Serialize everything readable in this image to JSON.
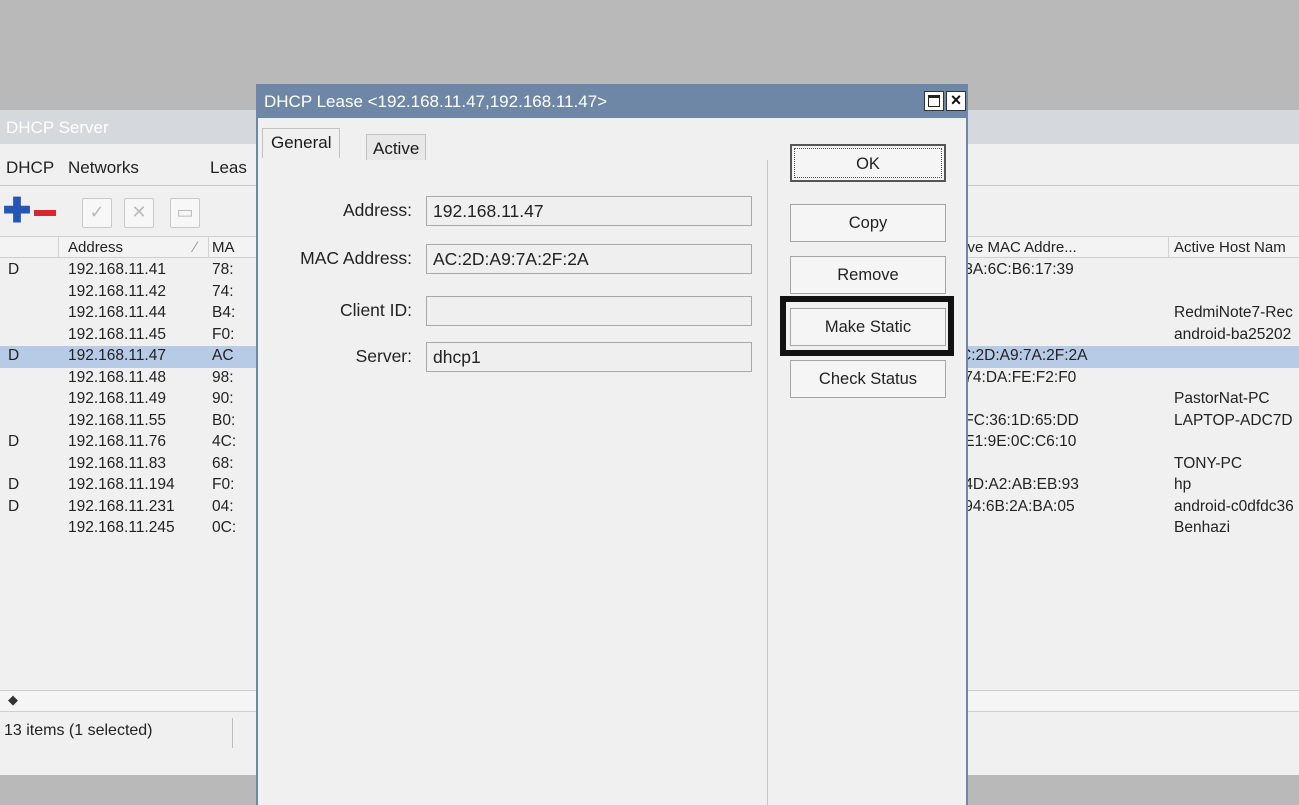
{
  "bg_window": {
    "title": "DHCP Server",
    "tabs": [
      "DHCP",
      "Networks",
      "Leas"
    ],
    "columns": {
      "address": "Address",
      "mac": "MA",
      "active_mac": "tive MAC Addre...",
      "active_host": "Active Host Nam"
    },
    "rows": [
      {
        "flag": "D",
        "address": "192.168.11.41",
        "mac": "78:",
        "active_mac": ":3A:6C:B6:17:39",
        "host": "",
        "selected": false
      },
      {
        "flag": "",
        "address": "192.168.11.42",
        "mac": "74:",
        "active_mac": "",
        "host": "",
        "selected": false
      },
      {
        "flag": "",
        "address": "192.168.11.44",
        "mac": "B4:",
        "active_mac": "",
        "host": "RedmiNote7-Rec",
        "selected": false
      },
      {
        "flag": "",
        "address": "192.168.11.45",
        "mac": "F0:",
        "active_mac": "",
        "host": "android-ba25202",
        "selected": false
      },
      {
        "flag": "D",
        "address": "192.168.11.47",
        "mac": "AC",
        "active_mac": "C:2D:A9:7A:2F:2A",
        "host": "",
        "selected": true
      },
      {
        "flag": "",
        "address": "192.168.11.48",
        "mac": "98:",
        "active_mac": ":74:DA:FE:F2:F0",
        "host": "",
        "selected": false
      },
      {
        "flag": "",
        "address": "192.168.11.49",
        "mac": "90:",
        "active_mac": "",
        "host": "PastorNat-PC",
        "selected": false
      },
      {
        "flag": "",
        "address": "192.168.11.55",
        "mac": "B0:",
        "active_mac": ":FC:36:1D:65:DD",
        "host": "LAPTOP-ADC7D",
        "selected": false
      },
      {
        "flag": "D",
        "address": "192.168.11.76",
        "mac": "4C:",
        "active_mac": ":E1:9E:0C:C6:10",
        "host": "",
        "selected": false
      },
      {
        "flag": "",
        "address": "192.168.11.83",
        "mac": "68:",
        "active_mac": "",
        "host": "TONY-PC",
        "selected": false
      },
      {
        "flag": "D",
        "address": "192.168.11.194",
        "mac": "F0:",
        "active_mac": ":4D:A2:AB:EB:93",
        "host": "hp",
        "selected": false
      },
      {
        "flag": "D",
        "address": "192.168.11.231",
        "mac": "04:",
        "active_mac": ":94:6B:2A:BA:05",
        "host": "android-c0dfdc36",
        "selected": false
      },
      {
        "flag": "",
        "address": "192.168.11.245",
        "mac": "0C:",
        "active_mac": "",
        "host": "Benhazi",
        "selected": false
      }
    ],
    "status": "13 items (1 selected)"
  },
  "dialog": {
    "title": "DHCP Lease <192.168.11.47,192.168.11.47>",
    "tabs": {
      "general": "General",
      "active": "Active"
    },
    "fields": {
      "address": {
        "label": "Address:",
        "value": "192.168.11.47"
      },
      "mac": {
        "label": "MAC Address:",
        "value": "AC:2D:A9:7A:2F:2A"
      },
      "client_id": {
        "label": "Client ID:",
        "value": ""
      },
      "server": {
        "label": "Server:",
        "value": "dhcp1"
      }
    },
    "buttons": {
      "ok": "OK",
      "copy": "Copy",
      "remove": "Remove",
      "make_static": "Make Static",
      "check_status": "Check Status"
    },
    "close_glyph": "×"
  }
}
